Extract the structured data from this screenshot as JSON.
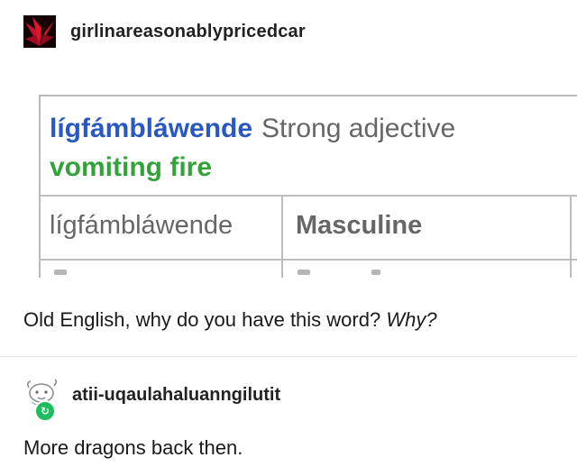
{
  "post": {
    "username": "girlinareasonablypricedcar",
    "avatar_icon": "red-flower-icon",
    "embedded_image": {
      "headword": "lígfámbláwende",
      "part_of_speech": "Strong adjective",
      "gloss": "vomiting fire",
      "table_cell_1": "lígfámbláwende",
      "table_cell_2": "Masculine"
    },
    "caption_text": "Old English, why do you have this word? ",
    "caption_emphasis": "Why?"
  },
  "reblog": {
    "username": "atii-uqaulahaluanngilutit",
    "avatar_icon": "doodle-avatar-icon",
    "badge_icon": "reblog-icon",
    "text": "More dragons back then."
  },
  "colors": {
    "headword": "#2a58c2",
    "gloss": "#34a23a",
    "reblog_badge": "#1fbd5e",
    "avatar_red": "#c8102e"
  }
}
